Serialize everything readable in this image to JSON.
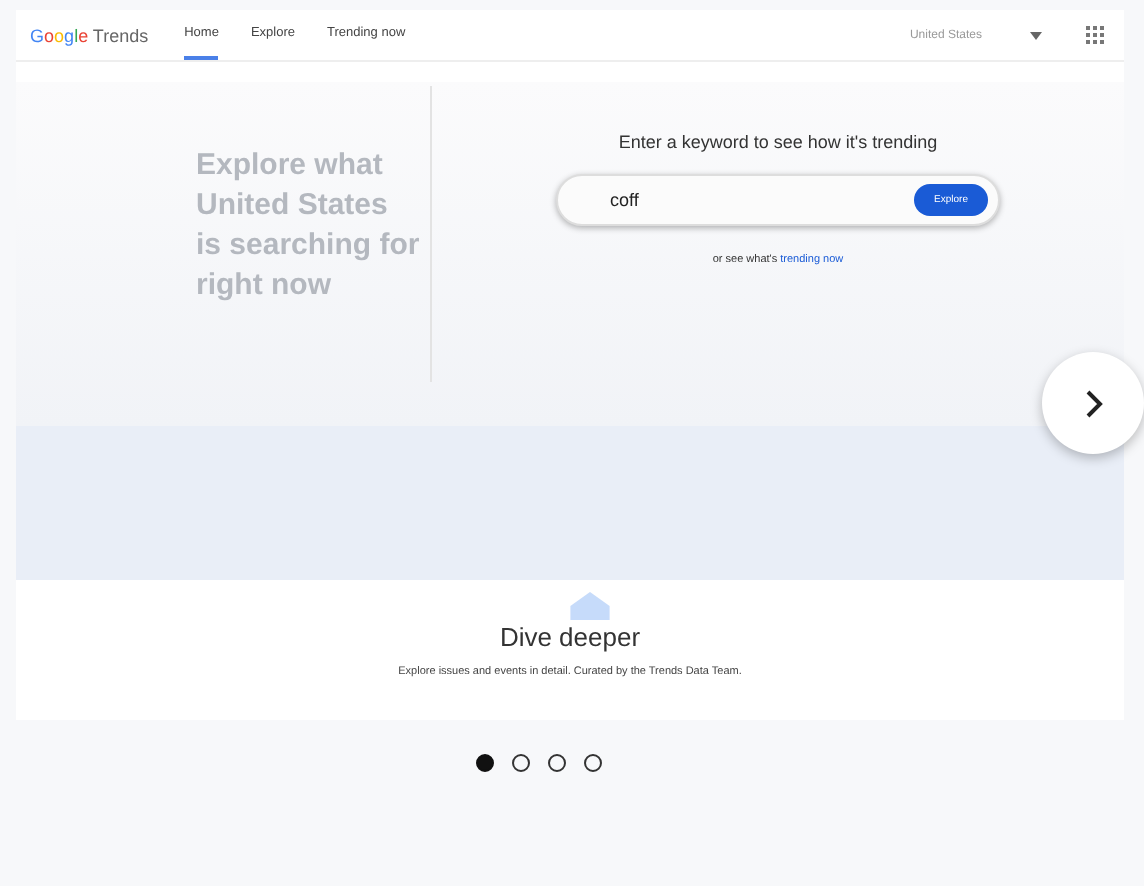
{
  "header": {
    "logo": {
      "brand": "Google",
      "product": "Trends"
    },
    "tabs": [
      {
        "label": "Home",
        "selected": true
      },
      {
        "label": "Explore",
        "selected": false
      },
      {
        "label": "Trending now",
        "selected": false
      }
    ],
    "region": "United States"
  },
  "hero": {
    "tagline": "Explore what United States is searching for right now",
    "prompt": "Enter a keyword to see how it's trending",
    "search": {
      "value": "coff",
      "button": "Explore"
    },
    "alt_text": "or see what's",
    "alt_link": "trending now"
  },
  "feature": {
    "title": "Dive deeper",
    "subtitle": "Explore issues and events in detail. Curated by the Trends Data Team."
  },
  "carousel": [
    {
      "selected": true
    },
    {
      "selected": false
    },
    {
      "selected": false
    },
    {
      "selected": false
    }
  ]
}
